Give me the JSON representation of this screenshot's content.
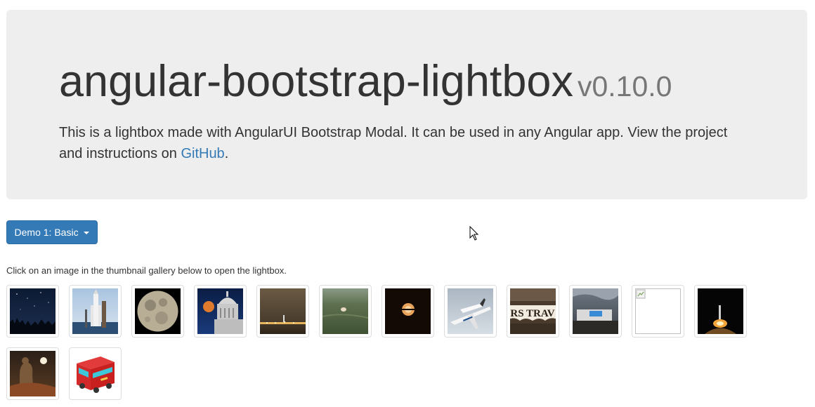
{
  "header": {
    "title": "angular-bootstrap-lightbox",
    "version": "v0.10.0",
    "description_before_link": "This is a lightbox made with AngularUI Bootstrap Modal. It can be used in any Angular app. View the project and instructions on ",
    "link_text": "GitHub",
    "description_after_link": "."
  },
  "demo_dropdown": {
    "label": "Demo 1: Basic"
  },
  "gallery": {
    "instruction": "Click on an image in the thumbnail gallery below to open the lightbox.",
    "thumbnails": [
      {
        "name": "thumbnail-night-sky",
        "subject": "starry night sky over trees"
      },
      {
        "name": "thumbnail-rocket-launchpad",
        "subject": "rocket on launch pad"
      },
      {
        "name": "thumbnail-moon",
        "subject": "full moon"
      },
      {
        "name": "thumbnail-moon-capitol",
        "subject": "moon rising behind capitol dome"
      },
      {
        "name": "thumbnail-city-night",
        "subject": "city lights at dusk"
      },
      {
        "name": "thumbnail-field-capsule",
        "subject": "capsule over green field"
      },
      {
        "name": "thumbnail-dark-moon",
        "subject": "moon in dark sky"
      },
      {
        "name": "thumbnail-shuttle-plane",
        "subject": "shuttle carried on jet"
      },
      {
        "name": "thumbnail-sign",
        "subject": "wooden sign"
      },
      {
        "name": "thumbnail-bus-sign",
        "subject": "bus with lit sign at dusk"
      },
      {
        "name": "thumbnail-broken-image",
        "subject": "broken image placeholder"
      },
      {
        "name": "thumbnail-rocket-night",
        "subject": "rocket launch at night"
      },
      {
        "name": "thumbnail-statue-moon",
        "subject": "statue with moon"
      },
      {
        "name": "thumbnail-red-bus",
        "subject": "red bus illustration"
      }
    ],
    "sign_text": "RS TRAV"
  },
  "colors": {
    "jumbotron_bg": "#eeeeee",
    "primary": "#337ab7",
    "link": "#337ab7",
    "version_text": "#777777"
  }
}
